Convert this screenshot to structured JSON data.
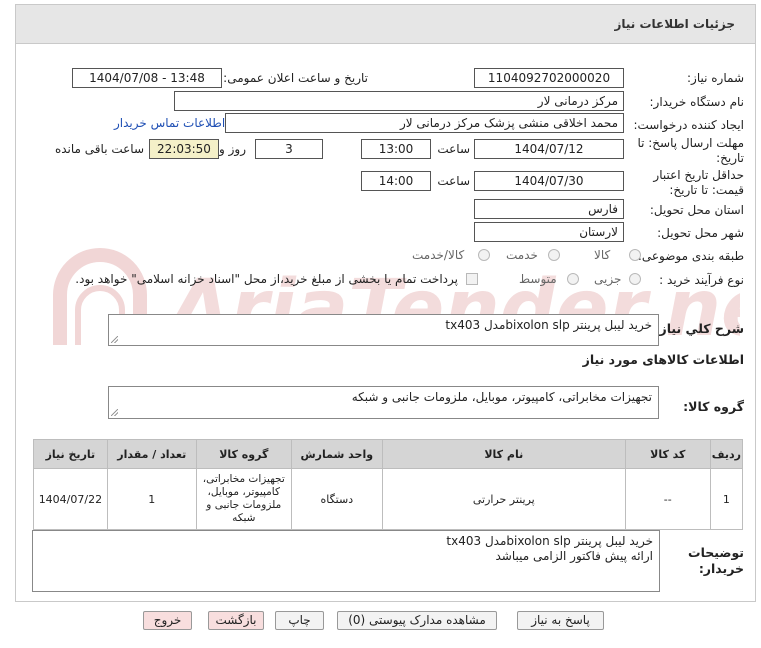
{
  "header": {
    "title": "جزئیات اطلاعات نیاز"
  },
  "fields": {
    "need_number_label": "شماره نیاز:",
    "need_number": "1104092702000020",
    "announce_label": "تاریخ و ساعت اعلان عمومی:",
    "announce_value": "1404/07/08 - 13:48",
    "buyer_org_label": "نام دستگاه خریدار:",
    "buyer_org": "مرکز درمانی لار",
    "requester_label": "ایجاد کننده درخواست:",
    "requester": "محمد  اخلاقی منشی پزشک مرکز درمانی لار",
    "contact_link": "اطلاعات تماس خریدار",
    "deadline_label_1": "مهلت ارسال پاسخ: تا",
    "deadline_label_2": "تاریخ:",
    "deadline_date": "1404/07/12",
    "time_label": "ساعت",
    "deadline_time": "13:00",
    "days_value": "3",
    "days_label": "روز و",
    "remaining_time": "22:03:50",
    "remaining_label": "ساعت باقی مانده",
    "validity_label_1": "حداقل تاریخ اعتبار",
    "validity_label_2": "قیمت: تا تاریخ:",
    "validity_date": "1404/07/30",
    "validity_time": "14:00",
    "province_label": "استان محل تحویل:",
    "province": "فارس",
    "city_label": "شهر محل تحویل:",
    "city": "لارستان",
    "category_label": "طبقه بندی موضوعی:",
    "category_options": [
      "کالا",
      "خدمت",
      "کالا/خدمت"
    ],
    "purchase_type_label": "نوع فرآیند خرید :",
    "purchase_options": [
      "جزیی",
      "متوسط"
    ],
    "payment_note": "پرداخت تمام یا بخشی از مبلغ خرید،از محل \"اسناد خزانه اسلامی\" خواهد بود."
  },
  "summary": {
    "label": "شرح کلي نياز:",
    "value": "خرید لیبل پرینتر bixolon slpمدل tx403"
  },
  "goods_info": {
    "title": "اطلاعات کالاهای مورد نیاز",
    "group_label": "گروه کالا:",
    "group_value": "تجهیزات مخابراتی، کامپیوتر، موبایل، ملزومات جانبی و شبکه"
  },
  "table": {
    "headers": [
      "ردیف",
      "کد کالا",
      "نام کالا",
      "واحد شمارش",
      "گروه کالا",
      "تعداد / مقدار",
      "تاریخ نیاز"
    ],
    "rows": [
      {
        "row": "1",
        "code": "--",
        "name": "پرینتر حرارتی",
        "unit": "دستگاه",
        "group": "تجهیزات مخابراتی، کامپیوتر، موبایل، ملزومات جانبی و شبکه",
        "qty": "1",
        "date": "1404/07/22"
      }
    ]
  },
  "buyer_notes": {
    "label_1": "توضیحات",
    "label_2": "خریدار:",
    "line1": "خرید لیبل پرینتر bixolon slpمدل tx403",
    "line2": "ارائه پیش فاکتور الزامی میباشد"
  },
  "buttons": {
    "reply": "پاسخ به نیاز",
    "attachments": "مشاهده مدارک پیوستی (0)",
    "print": "چاپ",
    "back": "بازگشت",
    "exit": "خروج"
  },
  "watermark_text": "AriaTender.neT"
}
